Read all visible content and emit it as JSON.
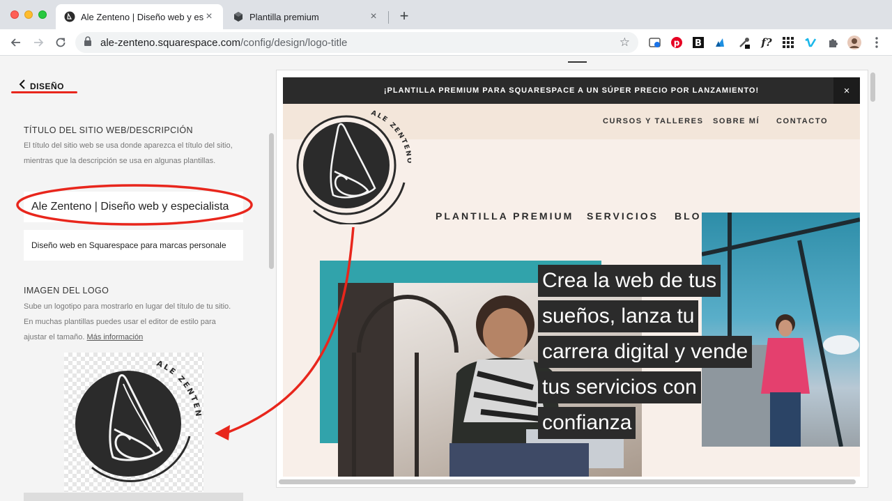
{
  "browser": {
    "tabs": [
      {
        "title": "Ale Zenteno | Diseño web y esp"
      },
      {
        "title": "Plantilla premium"
      }
    ],
    "url_host": "ale-zenteno.squarespace.com",
    "url_path": "/config/design/logo-title"
  },
  "editor": {
    "back_label": "DISEÑO",
    "site_title_section": {
      "heading": "TÍTULO DEL SITIO WEB/DESCRIPCIÓN",
      "description": "El título del sitio web se usa donde aparezca el título del sitio, mientras que la descripción se usa en algunas plantillas.",
      "title_value": "Ale Zenteno | Diseño web y especialista",
      "description_value": "Diseño web en Squarespace para marcas personale"
    },
    "logo_section": {
      "heading": "IMAGEN DEL LOGO",
      "description": "Sube un logotipo para mostrarlo en lugar del título de tu sitio. En muchas plantillas puedes usar el editor de estilo para ajustar el tamaño.",
      "link_text": "Más información"
    }
  },
  "preview": {
    "announcement": "¡PLANTILLA PREMIUM PARA SQUARESPACE A UN SÚPER PRECIO POR LANZAMIENTO!",
    "close_symbol": "×",
    "top_nav": [
      "CURSOS Y TALLERES",
      "SOBRE MÍ",
      "CONTACTO"
    ],
    "main_nav": [
      "PLANTILLA PREMIUM",
      "SERVICIOS",
      "BLOG"
    ],
    "logo_text": "ALE ZENTENO",
    "headline_lines": [
      "Crea la web de tus",
      "sueños, lanza tu",
      "carrera digital y vende",
      "tus servicios con",
      "confianza"
    ]
  },
  "colors": {
    "annotation": "#e8261c",
    "logo_dark": "#2b2b2b",
    "teal": "#31a3ab",
    "header_bg": "#f3e6da",
    "hero_bg": "#f8efe9"
  }
}
